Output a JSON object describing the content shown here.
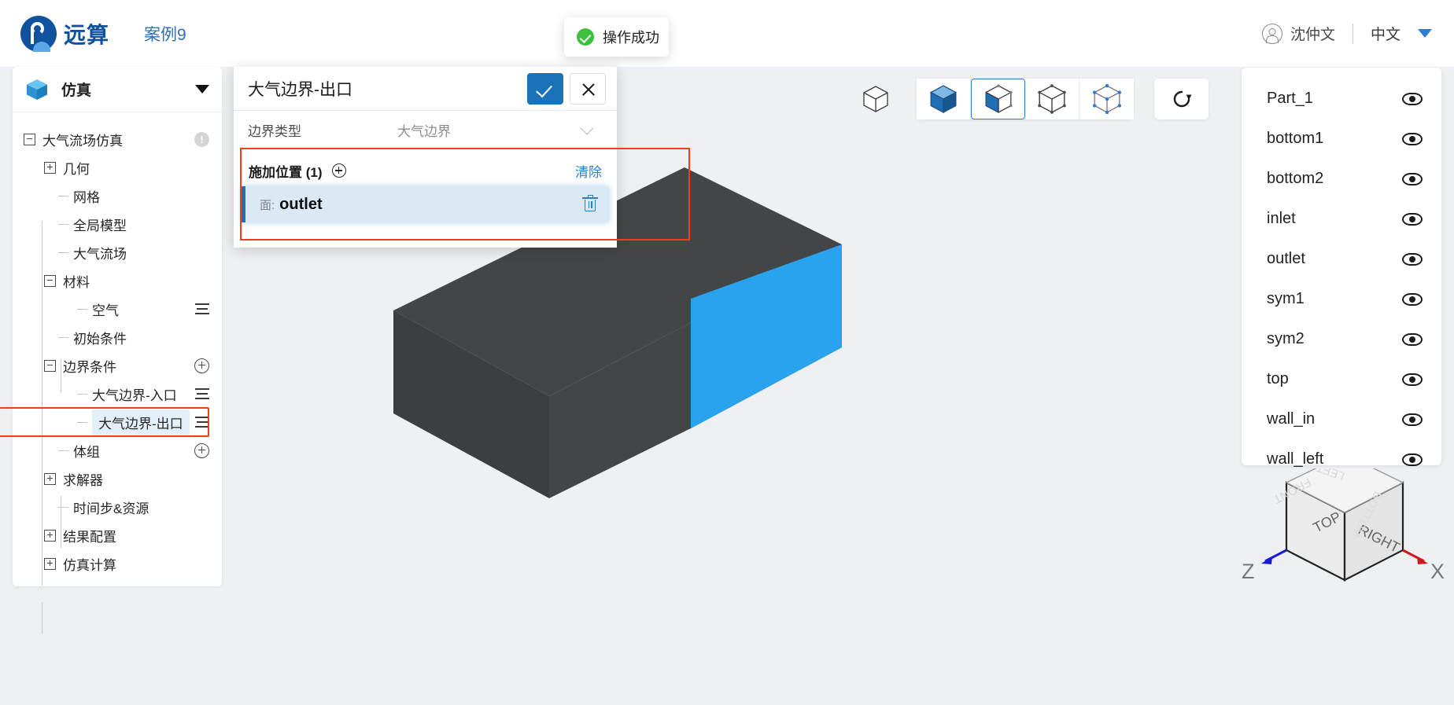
{
  "header": {
    "logo_text": "远算",
    "case_title": "案例9",
    "user_name": "沈仲文",
    "language": "中文"
  },
  "toast": {
    "message": "操作成功",
    "icon": "success-check-icon",
    "color": "#3ec03e"
  },
  "sidebar": {
    "title": "仿真",
    "items": [
      {
        "label": "大气流场仿真",
        "toggle": "minus",
        "depth": 0,
        "tail": "warn"
      },
      {
        "label": "几何",
        "toggle": "plus",
        "depth": 1,
        "tail": ""
      },
      {
        "label": "网格",
        "toggle": "stub",
        "depth": 2,
        "tail": ""
      },
      {
        "label": "全局模型",
        "toggle": "stub",
        "depth": 2,
        "tail": ""
      },
      {
        "label": "大气流场",
        "toggle": "stub",
        "depth": 2,
        "tail": ""
      },
      {
        "label": "材料",
        "toggle": "minus",
        "depth": 1,
        "tail": ""
      },
      {
        "label": "空气",
        "toggle": "stub",
        "depth": 3,
        "tail": "menu"
      },
      {
        "label": "初始条件",
        "toggle": "stub",
        "depth": 2,
        "tail": ""
      },
      {
        "label": "边界条件",
        "toggle": "minus",
        "depth": 1,
        "tail": "plus"
      },
      {
        "label": "大气边界-入口",
        "toggle": "stub",
        "depth": 3,
        "tail": "menu"
      },
      {
        "label": "大气边界-出口",
        "toggle": "stub",
        "depth": 3,
        "tail": "menu",
        "selected": true
      },
      {
        "label": "体组",
        "toggle": "stub",
        "depth": 2,
        "tail": "plus"
      },
      {
        "label": "求解器",
        "toggle": "plus",
        "depth": 1,
        "tail": ""
      },
      {
        "label": "时间步&资源",
        "toggle": "stub",
        "depth": 2,
        "tail": ""
      },
      {
        "label": "结果配置",
        "toggle": "plus",
        "depth": 1,
        "tail": ""
      },
      {
        "label": "仿真计算",
        "toggle": "plus",
        "depth": 1,
        "tail": ""
      }
    ]
  },
  "dialog": {
    "title": "大气边界-出口",
    "confirm_label": "",
    "cancel_label": "",
    "boundary_type_label": "边界类型",
    "boundary_type_value": "大气边界",
    "location_title": "施加位置 (1)",
    "clear_label": "清除",
    "location_items": [
      {
        "prefix": "面:",
        "name": "outlet"
      }
    ]
  },
  "toolbar": {
    "buttons": [
      {
        "name": "view-cube-plain",
        "active": false
      },
      {
        "name": "shade-solid",
        "active": false
      },
      {
        "name": "shade-face",
        "active": true
      },
      {
        "name": "shade-wireframe",
        "active": false
      },
      {
        "name": "shade-points",
        "active": false
      },
      {
        "name": "reset-view",
        "active": false
      }
    ]
  },
  "parts_panel": {
    "items": [
      {
        "label": "Part_1",
        "visible": true
      },
      {
        "label": "bottom1",
        "visible": true
      },
      {
        "label": "bottom2",
        "visible": true
      },
      {
        "label": "inlet",
        "visible": true
      },
      {
        "label": "outlet",
        "visible": true
      },
      {
        "label": "sym1",
        "visible": true
      },
      {
        "label": "sym2",
        "visible": true
      },
      {
        "label": "top",
        "visible": true
      },
      {
        "label": "wall_in",
        "visible": true
      },
      {
        "label": "wall_left",
        "visible": true
      }
    ]
  },
  "gizmo": {
    "face_top": "TOP",
    "face_right": "RIGHT",
    "face_front": "FRONT",
    "face_left": "LEFT",
    "face_bottom": "BOTTOM",
    "axis_z": "Z",
    "axis_x": "X",
    "axis_z_color": "#1a1ad0",
    "axis_x_color": "#d01a1a"
  },
  "model": {
    "body_color": "#434648",
    "body_color_dark": "#3c3f41",
    "selected_face_color": "#29a3ee",
    "selected_face_name": "outlet"
  },
  "theme": {
    "accent": "#1a72b8",
    "highlight_outline": "#f43c18",
    "link": "#2f7bd6",
    "page_bg": "#eef0f4"
  }
}
